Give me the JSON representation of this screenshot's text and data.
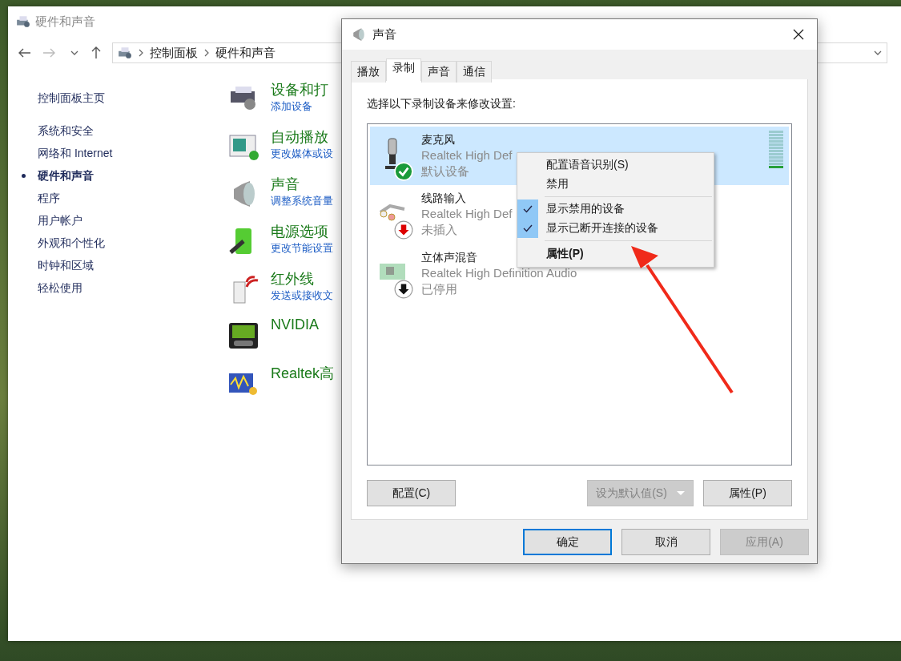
{
  "window": {
    "title": "硬件和声音"
  },
  "address_bar": {
    "breadcrumb": [
      "控制面板",
      "硬件和声音"
    ]
  },
  "sidebar": {
    "items": [
      {
        "label": "控制面板主页",
        "selected": false
      },
      {
        "label": "系统和安全",
        "selected": false
      },
      {
        "label": "网络和 Internet",
        "selected": false
      },
      {
        "label": "硬件和声音",
        "selected": true
      },
      {
        "label": "程序",
        "selected": false
      },
      {
        "label": "用户帐户",
        "selected": false
      },
      {
        "label": "外观和个性化",
        "selected": false
      },
      {
        "label": "时钟和区域",
        "selected": false
      },
      {
        "label": "轻松使用",
        "selected": false
      }
    ]
  },
  "categories": [
    {
      "kind": "devices",
      "title": "设备和打",
      "links": [
        "添加设备"
      ]
    },
    {
      "kind": "autoplay",
      "title": "自动播放",
      "links": [
        "更改媒体或设"
      ]
    },
    {
      "kind": "sound",
      "title": "声音",
      "links": [
        "调整系统音量"
      ]
    },
    {
      "kind": "power",
      "title": "电源选项",
      "links": [
        "更改节能设置"
      ]
    },
    {
      "kind": "infrared",
      "title": "红外线",
      "links": [
        "发送或接收文"
      ]
    },
    {
      "kind": "nvidia",
      "title": "NVIDIA"
    },
    {
      "kind": "realtek",
      "title": "Realtek高"
    }
  ],
  "dialog": {
    "title": "声音",
    "tabs": [
      {
        "label": "播放",
        "selected": false
      },
      {
        "label": "录制",
        "selected": true
      },
      {
        "label": "声音",
        "selected": false
      },
      {
        "label": "通信",
        "selected": false
      }
    ],
    "instruction": "选择以下录制设备来修改设置:",
    "devices": [
      {
        "kind": "microphone",
        "is_default": true,
        "enabled": true,
        "name": "麦克风",
        "driver": "Realtek High Def",
        "status": "默认设备",
        "selected": true,
        "level": 0.1
      },
      {
        "kind": "line-in",
        "is_default": false,
        "enabled": true,
        "name": "线路输入",
        "driver": "Realtek High Def",
        "status": "未插入",
        "selected": false
      },
      {
        "kind": "sound-card",
        "is_default": false,
        "enabled": false,
        "name": "立体声混音",
        "driver": "Realtek High Definition Audio",
        "status": "已停用",
        "selected": false
      }
    ],
    "list_buttons": [
      {
        "label": "配置(C)",
        "disabled": false,
        "split": false
      },
      {
        "label": "设为默认值(S)",
        "disabled": true,
        "split": true
      },
      {
        "label": "属性(P)",
        "disabled": false,
        "split": false
      }
    ],
    "footer_buttons": [
      {
        "label": "确定",
        "disabled": false,
        "default": true
      },
      {
        "label": "取消",
        "disabled": false,
        "default": false
      },
      {
        "label": "应用(A)",
        "disabled": true,
        "default": false
      }
    ]
  },
  "context_menu": {
    "groups": [
      [
        {
          "label": "配置语音识别(S)",
          "checked": false,
          "default": false
        },
        {
          "label": "禁用",
          "checked": false,
          "default": false
        }
      ],
      [
        {
          "label": "显示禁用的设备",
          "checked": true,
          "default": false
        },
        {
          "label": "显示已断开连接的设备",
          "checked": true,
          "default": false
        }
      ],
      [
        {
          "label": "属性(P)",
          "checked": false,
          "default": true
        }
      ]
    ]
  }
}
